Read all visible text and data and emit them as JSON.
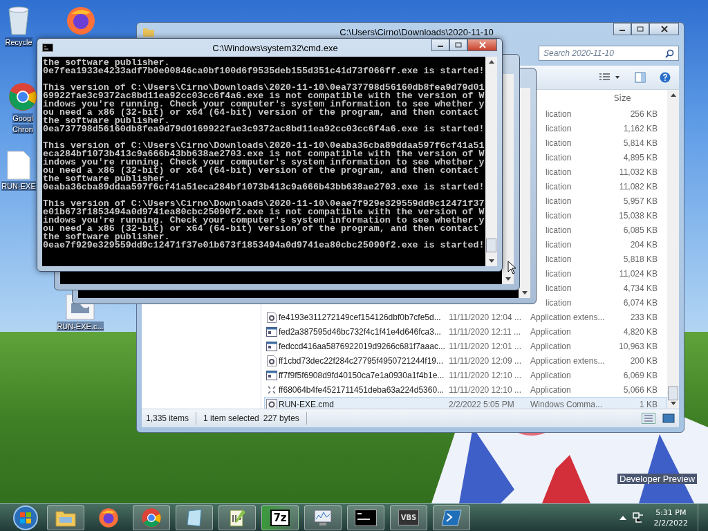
{
  "desktop_icons": [
    {
      "kind": "recycle",
      "label_lines": [
        "Recycle"
      ]
    },
    {
      "kind": "firefox"
    },
    {
      "kind": "chrome",
      "label_lines": [
        "Googl",
        "Chron"
      ]
    },
    {
      "kind": "document",
      "label_lines": [
        "RUN-EXE"
      ]
    },
    {
      "kind": "script",
      "label_lines": [
        "RUN-EXE.c..."
      ]
    }
  ],
  "explorer": {
    "title": "C:\\Users\\Cirno\\Downloads\\2020-11-10",
    "search": {
      "placeholder": "Search 2020-11-10"
    },
    "size_header": "Size",
    "rows": [
      {
        "kind": "partial",
        "type": "lication",
        "size": "256 KB",
        "selected": false
      },
      {
        "kind": "partial",
        "type": "lication",
        "size": "1,162 KB",
        "selected": false
      },
      {
        "kind": "partial",
        "type": "lication",
        "size": "5,814 KB",
        "selected": false
      },
      {
        "kind": "partial",
        "type": "lication",
        "size": "4,895 KB",
        "selected": false
      },
      {
        "kind": "partial",
        "type": "lication",
        "size": "11,032 KB",
        "selected": false
      },
      {
        "kind": "partial",
        "type": "lication",
        "size": "11,082 KB",
        "selected": false
      },
      {
        "kind": "partial",
        "type": "lication",
        "size": "5,957 KB",
        "selected": false
      },
      {
        "kind": "partial",
        "type": "lication",
        "size": "15,038 KB",
        "selected": false
      },
      {
        "kind": "partial",
        "type": "lication",
        "size": "6,085 KB",
        "selected": false
      },
      {
        "kind": "partial",
        "type": "lication",
        "size": "204 KB",
        "selected": false
      },
      {
        "kind": "partial",
        "type": "lication",
        "size": "5,818 KB",
        "selected": false
      },
      {
        "kind": "partial",
        "type": "lication",
        "size": "11,024 KB",
        "selected": false
      },
      {
        "kind": "partial",
        "type": "lication",
        "size": "4,734 KB",
        "selected": false
      },
      {
        "kind": "partial",
        "type": "lication",
        "size": "6,074 KB",
        "selected": false
      },
      {
        "kind": "extension",
        "name": "fe4193e311272149cef154126dbf0b7cfe5d...",
        "date": "11/11/2020 12:04 ...",
        "type": "Application extens...",
        "size": "233 KB",
        "selected": false
      },
      {
        "kind": "application",
        "name": "fed2a387595d46bc732f4c1f41e4d646fca3...",
        "date": "11/11/2020 12:11 ...",
        "type": "Application",
        "size": "4,820 KB",
        "selected": false
      },
      {
        "kind": "application",
        "name": "fedccd416aa5876922019d9266c681f7aaac...",
        "date": "11/11/2020 12:01 ...",
        "type": "Application",
        "size": "10,963 KB",
        "selected": false
      },
      {
        "kind": "extension",
        "name": "ff1cbd73dec22f284c27795f4950721244f19...",
        "date": "11/11/2020 12:09 ...",
        "type": "Application extens...",
        "size": "200 KB",
        "selected": false
      },
      {
        "kind": "application",
        "name": "ff7f9f5f6908d9fd40150ca7e1a0930a1f4b1e...",
        "date": "11/11/2020 12:10 ...",
        "type": "Application",
        "size": "6,069 KB",
        "selected": false
      },
      {
        "kind": "broken",
        "name": "ff68064b4fe4521711451deba63a224d5360...",
        "date": "11/11/2020 12:10 ...",
        "type": "Application",
        "size": "5,066 KB",
        "selected": false
      },
      {
        "kind": "script",
        "name": "RUN-EXE.cmd",
        "date": "2/2/2022 5:05 PM",
        "type": "Windows Comma...",
        "size": "1 KB",
        "selected": true
      }
    ],
    "status": {
      "items": "1,335 items",
      "selection": "1 item selected",
      "bytes": "227 bytes"
    }
  },
  "console": {
    "title": "C:\\Windows\\system32\\cmd.exe",
    "blocks": [
      [
        "the software publisher.",
        "0e7fea1933e4233adf7b0e00846ca0bf100d6f9535deb155d351c41d73f066ff.exe is started!"
      ],
      [
        "This version of C:\\Users\\Cirno\\Downloads\\2020-11-10\\0ea737798d56160db8fea9d79d01",
        "69922fae3c9372ac8bd11ea92cc03cc6f4a6.exe is not compatible with the version of W",
        "indows you're running. Check your computer's system information to see whether y",
        "ou need a x86 (32-bit) or x64 (64-bit) version of the program, and then contact",
        "the software publisher.",
        "0ea737798d56160db8fea9d79d0169922fae3c9372ac8bd11ea92cc03cc6f4a6.exe is started!"
      ],
      [
        "This version of C:\\Users\\Cirno\\Downloads\\2020-11-10\\0eaba36cba89ddaa597f6cf41a51",
        "eca284bf1073b413c9a666b43bb638ae2703.exe is not compatible with the version of W",
        "indows you're running. Check your computer's system information to see whether y",
        "ou need a x86 (32-bit) or x64 (64-bit) version of the program, and then contact",
        "the software publisher.",
        "0eaba36cba89ddaa597f6cf41a51eca284bf1073b413c9a666b43bb638ae2703.exe is started!"
      ],
      [
        "This version of C:\\Users\\Cirno\\Downloads\\2020-11-10\\0eae7f929e329559dd9c12471f37",
        "e01b673f1853494a0d9741ea80cbc25090f2.exe is not compatible with the version of W",
        "indows you're running. Check your computer's system information to see whether y",
        "ou need a x86 (32-bit) or x64 (64-bit) version of the program, and then contact",
        "the software publisher.",
        "0eae7f929e329559dd9c12471f37e01b673f1853494a0d9741ea80cbc25090f2.exe is started!"
      ]
    ]
  },
  "desktop_watermark": "Developer Preview",
  "taskbar": {
    "items": [
      {
        "kind": "explorer"
      },
      {
        "kind": "firefox"
      },
      {
        "kind": "chrome"
      },
      {
        "kind": "notepad"
      },
      {
        "kind": "notepadpp"
      },
      {
        "kind": "sevenzip",
        "label": "7z"
      },
      {
        "kind": "monitor"
      },
      {
        "kind": "console"
      },
      {
        "kind": "vbs",
        "label": "VBS"
      },
      {
        "kind": "powershell"
      }
    ],
    "time": "5:31 PM",
    "date": "2/2/2022"
  }
}
